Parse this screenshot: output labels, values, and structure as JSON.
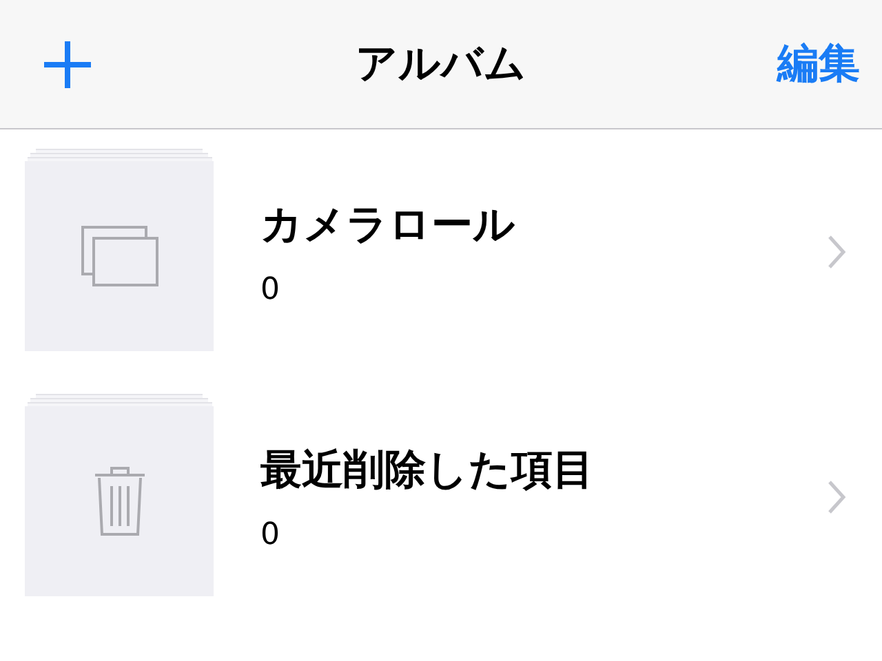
{
  "nav": {
    "title": "アルバム",
    "edit_button": "編集"
  },
  "albums": [
    {
      "kind": "camera-roll",
      "title": "カメラロール",
      "count": "0"
    },
    {
      "kind": "trash",
      "title": "最近削除した項目",
      "count": "0"
    }
  ]
}
